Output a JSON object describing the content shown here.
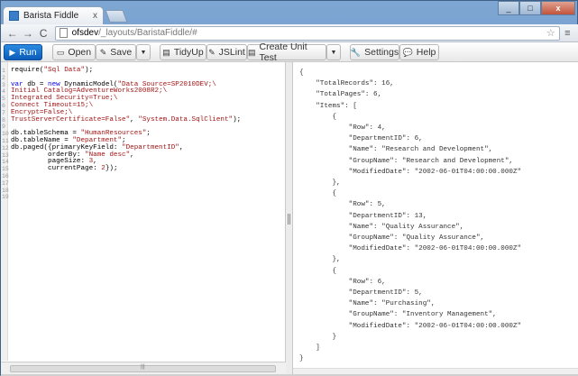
{
  "browser": {
    "tab_title": "Barista Fiddle",
    "tab_close": "x",
    "url_host": "ofsdev",
    "url_path": "/_layouts/BaristaFiddle/#",
    "back": "←",
    "forward": "→",
    "reload": "C",
    "star": "☆",
    "menu": "≡"
  },
  "toolbar": {
    "run": "Run",
    "open": "Open",
    "save": "Save",
    "tidyup": "TidyUp",
    "jslint": "JSLint",
    "create_unit_test": "Create Unit Test",
    "settings": "Settings",
    "help": "Help"
  },
  "editor": {
    "line_numbers": "1\n2\n3\n4\n5\n6\n7\n8\n9\n10\n11\n12\n13\n14\n15\n16\n17\n18\n19",
    "lines": [
      {
        "parts": [
          {
            "t": "require(",
            "c": ""
          },
          {
            "t": "\"Sql Data\"",
            "c": "str"
          },
          {
            "t": ");",
            "c": ""
          }
        ]
      },
      {
        "parts": [
          {
            "t": "",
            "c": ""
          }
        ]
      },
      {
        "parts": [
          {
            "t": "var",
            "c": "kw"
          },
          {
            "t": " db = ",
            "c": ""
          },
          {
            "t": "new",
            "c": "kw"
          },
          {
            "t": " DynamicModel(",
            "c": ""
          },
          {
            "t": "\"Data Source=SP2010DEV;\\",
            "c": "str"
          }
        ]
      },
      {
        "parts": [
          {
            "t": "Initial Catalog=AdventureWorks2008R2;\\",
            "c": "str"
          }
        ]
      },
      {
        "parts": [
          {
            "t": "Integrated Security=True;\\",
            "c": "str"
          }
        ]
      },
      {
        "parts": [
          {
            "t": "Connect Timeout=15;\\",
            "c": "str"
          }
        ]
      },
      {
        "parts": [
          {
            "t": "Encrypt=False;\\",
            "c": "str"
          }
        ]
      },
      {
        "parts": [
          {
            "t": "TrustServerCertificate=False\"",
            "c": "str"
          },
          {
            "t": ", ",
            "c": ""
          },
          {
            "t": "\"System.Data.SqlClient\"",
            "c": "str"
          },
          {
            "t": ");",
            "c": ""
          }
        ]
      },
      {
        "parts": [
          {
            "t": "",
            "c": ""
          }
        ]
      },
      {
        "parts": [
          {
            "t": "db.tableSchema = ",
            "c": ""
          },
          {
            "t": "\"HumanResources\"",
            "c": "str"
          },
          {
            "t": ";",
            "c": ""
          }
        ]
      },
      {
        "parts": [
          {
            "t": "db.tableName = ",
            "c": ""
          },
          {
            "t": "\"Department\"",
            "c": "str"
          },
          {
            "t": ";",
            "c": ""
          }
        ]
      },
      {
        "parts": [
          {
            "t": "db.paged({primaryKeyField: ",
            "c": ""
          },
          {
            "t": "\"DepartmentID\"",
            "c": "str"
          },
          {
            "t": ",",
            "c": ""
          }
        ]
      },
      {
        "parts": [
          {
            "t": "         orderBy: ",
            "c": ""
          },
          {
            "t": "\"Name desc\"",
            "c": "str"
          },
          {
            "t": ",",
            "c": ""
          }
        ]
      },
      {
        "parts": [
          {
            "t": "         pageSize: ",
            "c": ""
          },
          {
            "t": "3",
            "c": "str"
          },
          {
            "t": ",",
            "c": ""
          }
        ]
      },
      {
        "parts": [
          {
            "t": "         currentPage: ",
            "c": ""
          },
          {
            "t": "2",
            "c": "str"
          },
          {
            "t": "});",
            "c": ""
          }
        ]
      }
    ]
  },
  "output": {
    "json_text": "{\n    \"TotalRecords\": 16,\n    \"TotalPages\": 6,\n    \"Items\": [\n        {\n            \"Row\": 4,\n            \"DepartmentID\": 6,\n            \"Name\": \"Research and Development\",\n            \"GroupName\": \"Research and Development\",\n            \"ModifiedDate\": \"2002-06-01T04:00:00.000Z\"\n        },\n        {\n            \"Row\": 5,\n            \"DepartmentID\": 13,\n            \"Name\": \"Quality Assurance\",\n            \"GroupName\": \"Quality Assurance\",\n            \"ModifiedDate\": \"2002-06-01T04:00:00.000Z\"\n        },\n        {\n            \"Row\": 6,\n            \"DepartmentID\": 5,\n            \"Name\": \"Purchasing\",\n            \"GroupName\": \"Inventory Management\",\n            \"ModifiedDate\": \"2002-06-01T04:00:00.000Z\"\n        }\n    ]\n}"
  },
  "icons": {
    "run": "▶",
    "open": "▭",
    "save": "✎",
    "tidyup": "▤",
    "jslint": "✎",
    "settings": "🔧",
    "help": "💬",
    "caret": "▼",
    "grip": "|||"
  },
  "colors": {
    "run_button": "#1565c0",
    "string": "#a31515",
    "keyword": "#0000ff"
  }
}
